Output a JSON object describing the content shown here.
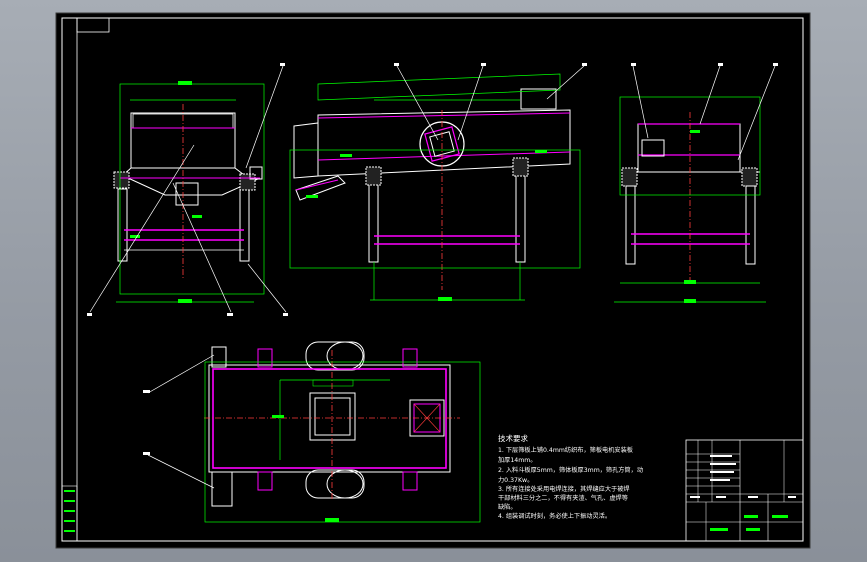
{
  "viewport": {
    "background": "#9aa0a8",
    "paper_color": "#000000"
  },
  "colors": {
    "frame": "#ffffff",
    "dimension": "#00ff00",
    "part_outline": "#ffffff",
    "accent_magenta": "#ff00ff",
    "centerline": "#ff3b3b",
    "leader": "#ffffff",
    "hatch": "#bbbbbb"
  },
  "technical_requirements": {
    "heading": "技术要求",
    "lines": [
      "1. 下层筛板上铺0.4mm纺织布，筛板电机安装板",
      "   加厚14mm。",
      "2. 入料斗板厚5mm，筛体板厚3mm，筛孔方筒，动",
      "   力0.37Kw。",
      "3. 所有连接处采用电焊连接，其焊缝应大于被焊",
      "   干部材料三分之二，不得有夹渣、气孔、虚焊等",
      "   缺陷。",
      "4. 组装调试时刻，务必使上下振动灵活。"
    ]
  },
  "icons": {
    "paper_frame": "drawing-border-icon",
    "title_block": "title-block-icon"
  }
}
